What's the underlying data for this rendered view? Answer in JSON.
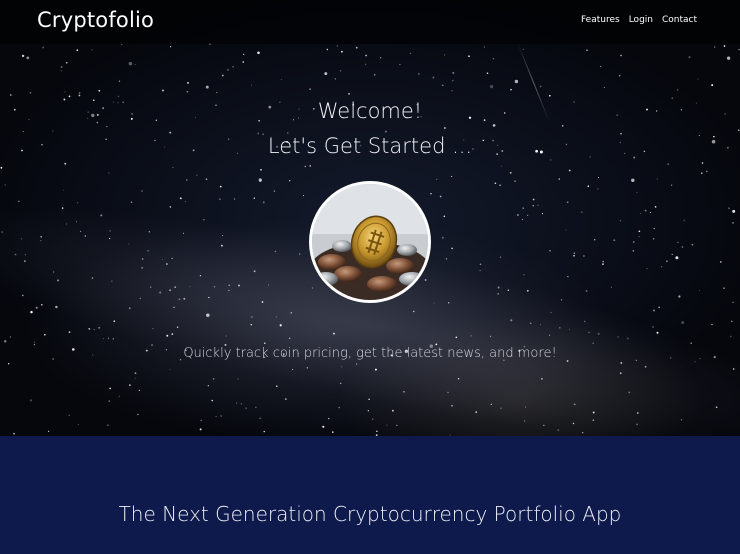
{
  "navbar": {
    "brand": "Cryptofolio",
    "links": [
      {
        "label": "Features"
      },
      {
        "label": "Login"
      },
      {
        "label": "Contact"
      }
    ]
  },
  "hero": {
    "title_line1": "Welcome!",
    "title_line2": "Let's Get Started ...",
    "image_icon": "coin-photo",
    "subtitle": "Quickly track coin pricing, get the latest news, and more!"
  },
  "section": {
    "title": "The Next Generation Cryptocurrency Portfolio App"
  },
  "colors": {
    "section_background": "#0f1a4c",
    "hero_background": "#04060b",
    "text": "#ffffff"
  }
}
